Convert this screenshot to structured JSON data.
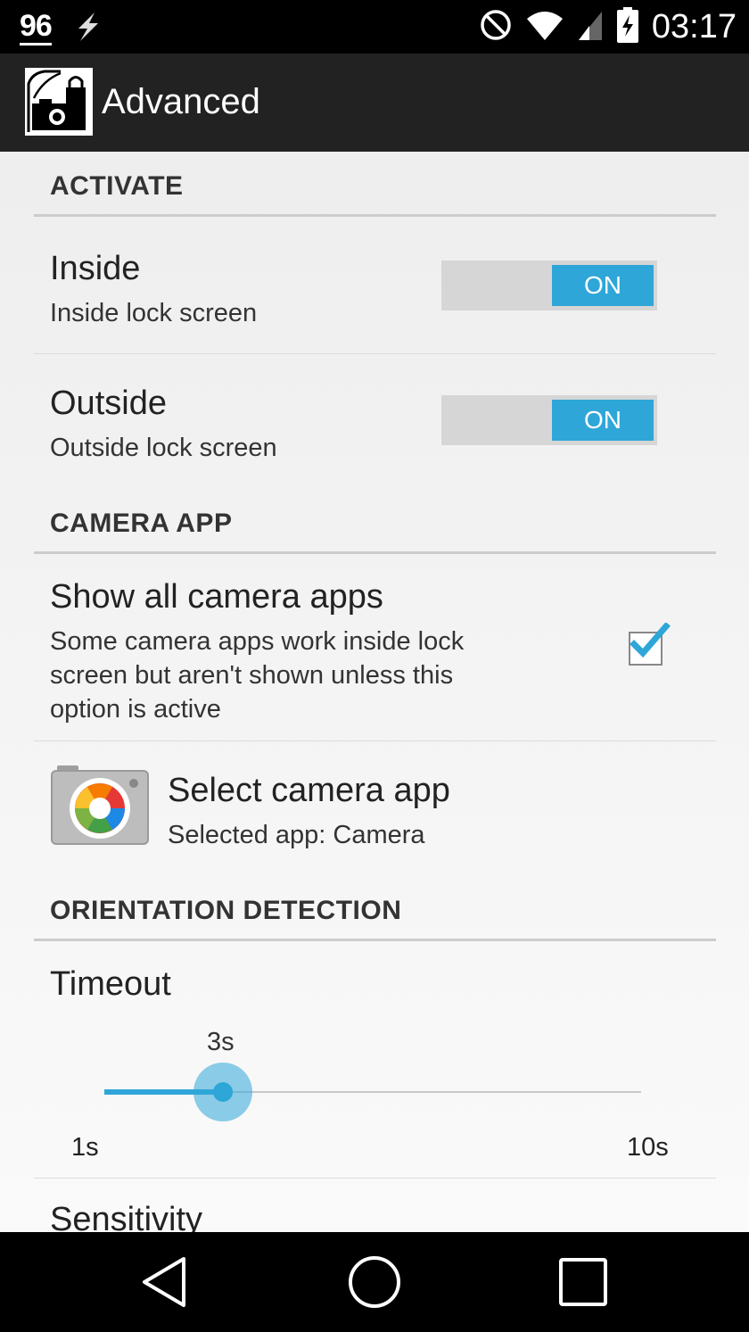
{
  "status_bar": {
    "battery_percent": "96",
    "time": "03:17",
    "icons": [
      "bolt-icon",
      "do-not-disturb-icon",
      "wifi-icon",
      "signal-icon",
      "battery-charging-icon"
    ]
  },
  "action_bar": {
    "title": "Advanced",
    "icon": "app-lock-camera-icon"
  },
  "sections": {
    "activate": {
      "header": "ACTIVATE",
      "inside": {
        "title": "Inside",
        "subtitle": "Inside lock screen",
        "toggle_label": "ON",
        "checked": true
      },
      "outside": {
        "title": "Outside",
        "subtitle": "Outside lock screen",
        "toggle_label": "ON",
        "checked": true
      }
    },
    "camera_app": {
      "header": "CAMERA APP",
      "show_all": {
        "title": "Show all camera apps",
        "subtitle_lines": [
          "Some camera apps work inside lock",
          "screen but aren't shown unless this",
          "option is active"
        ],
        "checked": true
      },
      "select": {
        "title": "Select camera app",
        "subtitle": "Selected app: Camera",
        "icon": "camera-app-icon"
      }
    },
    "orientation": {
      "header": "ORIENTATION DETECTION",
      "timeout": {
        "title": "Timeout",
        "value_label": "3s",
        "value": 3,
        "min_label": "1s",
        "max_label": "10s",
        "min": 1,
        "max": 10
      },
      "sensitivity": {
        "title": "Sensitivity"
      }
    }
  },
  "nav_bar": {
    "buttons": [
      "back-icon",
      "home-icon",
      "recents-icon"
    ]
  },
  "colors": {
    "accent": "#2fa6d8",
    "action_bar": "#222222",
    "status_bar": "#000000"
  }
}
